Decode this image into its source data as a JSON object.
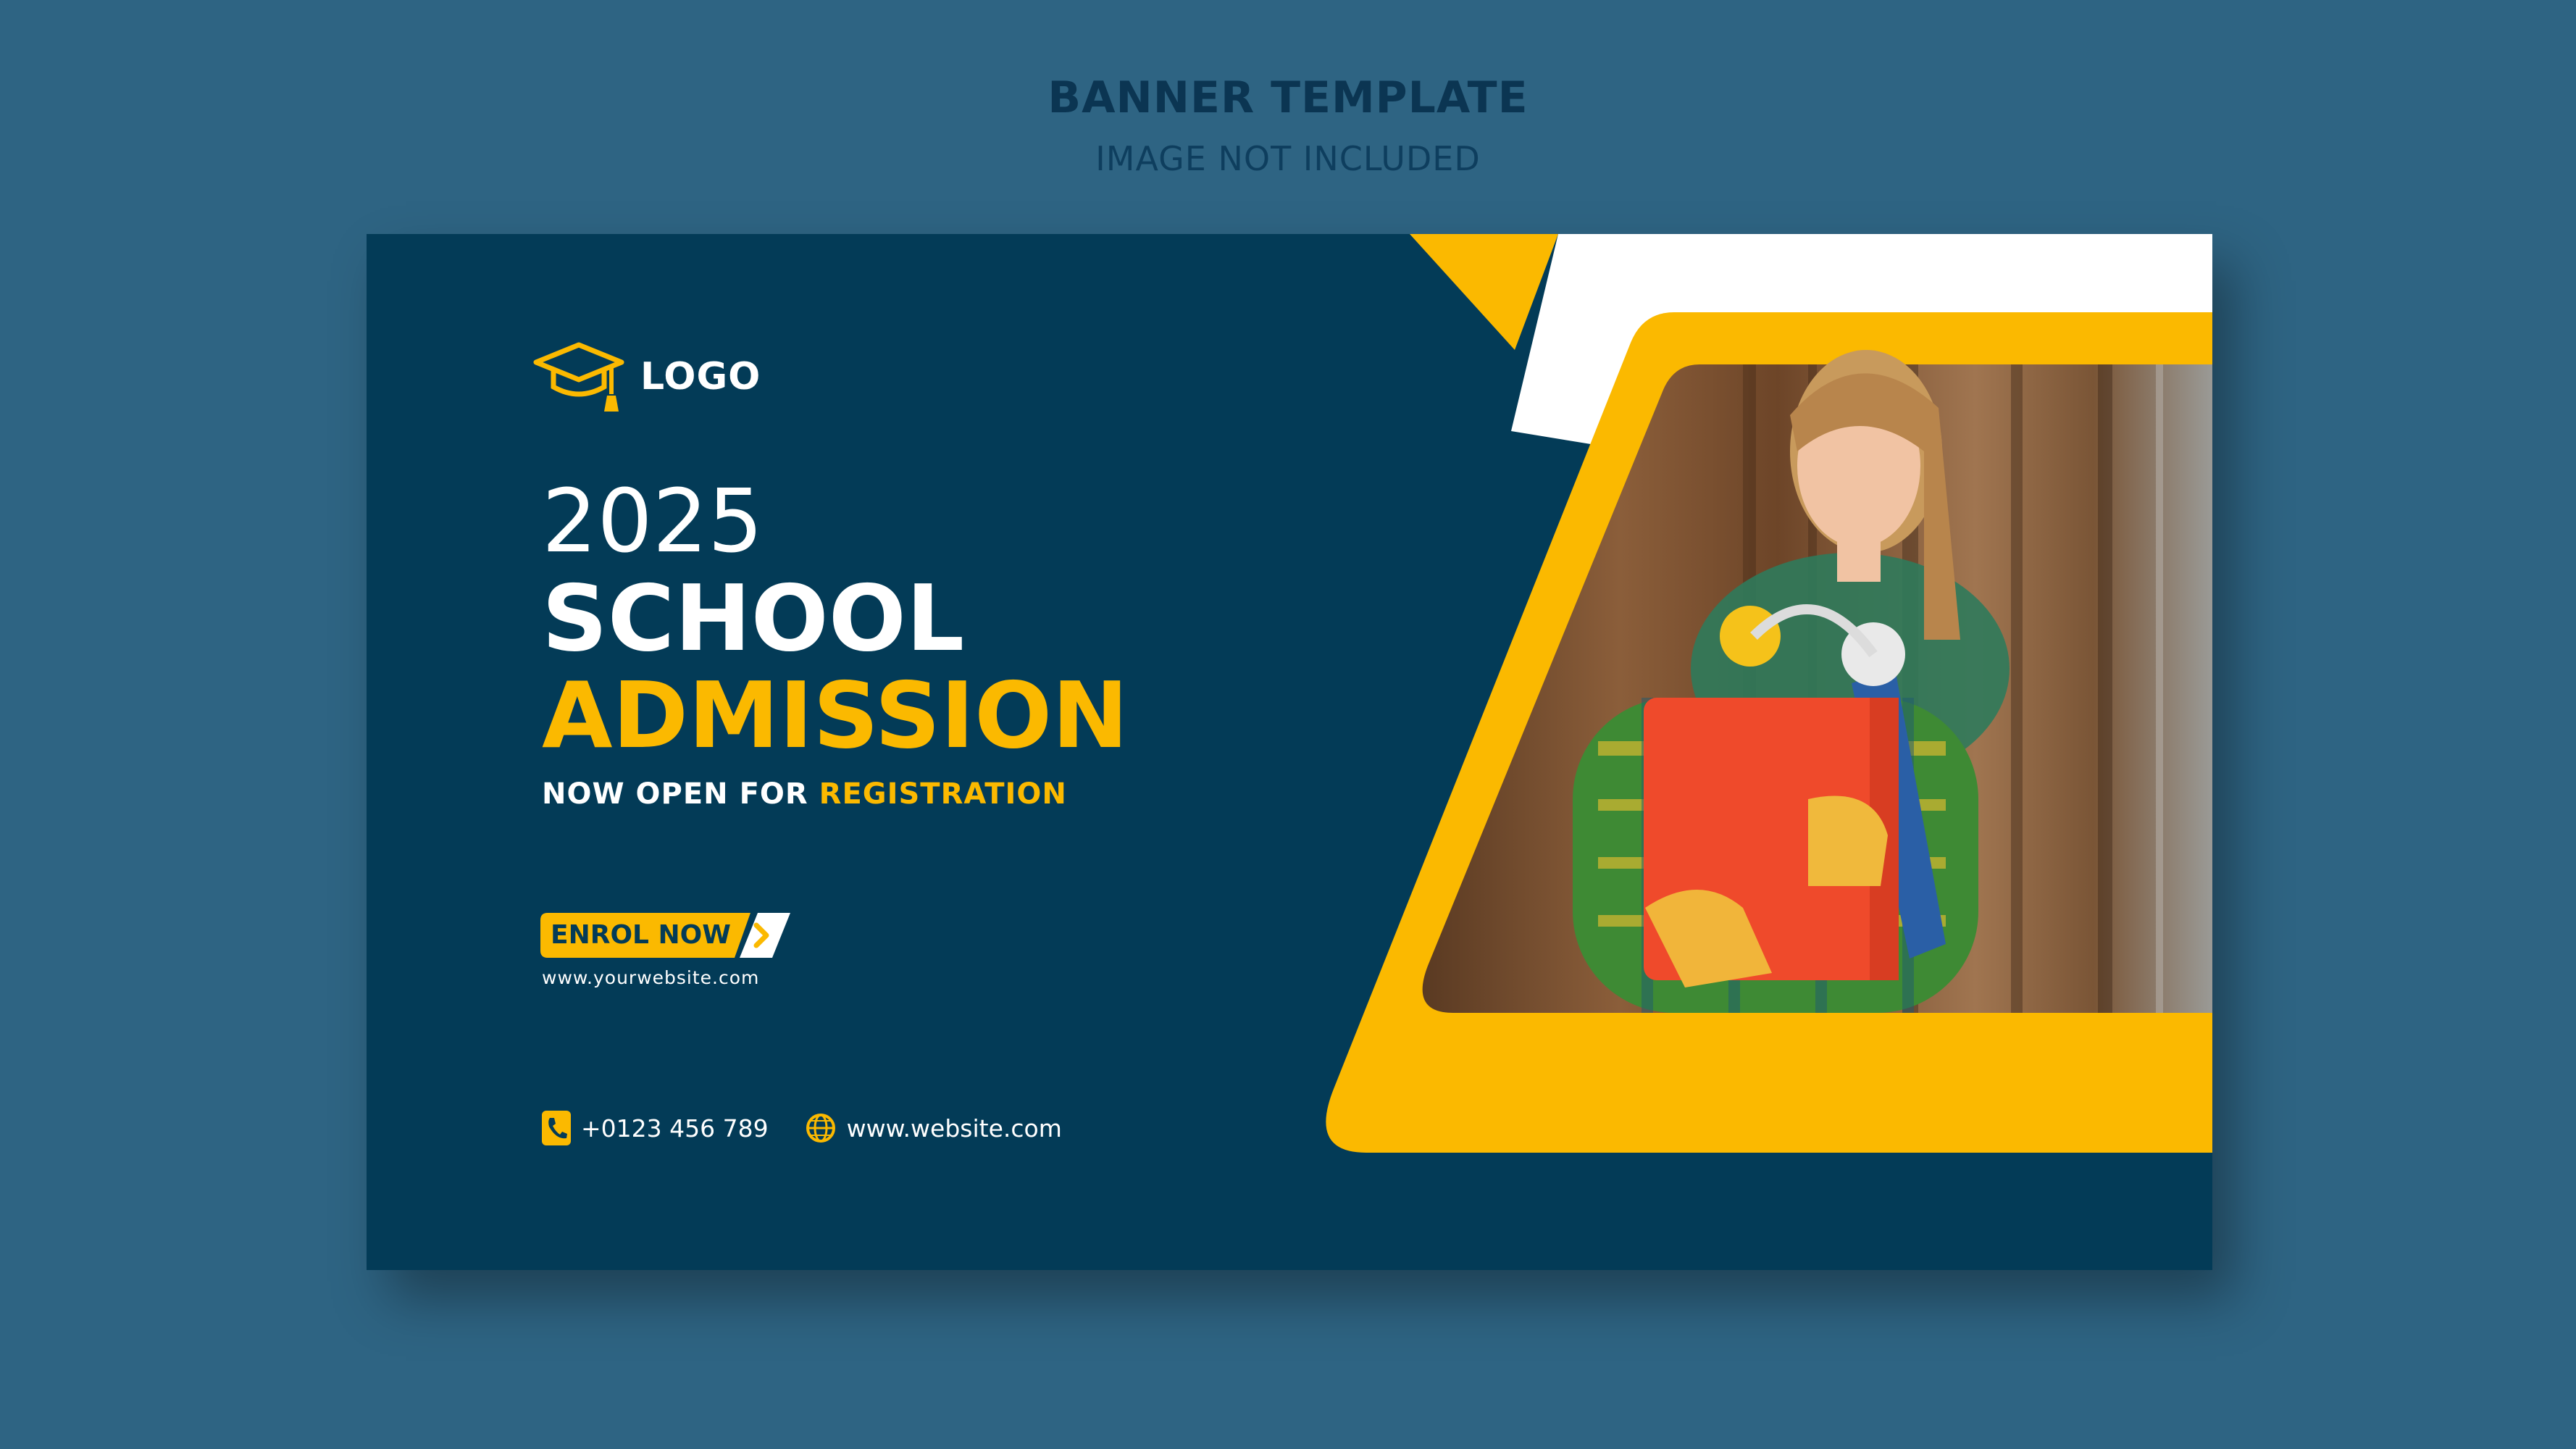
{
  "header": {
    "title": "BANNER TEMPLATE",
    "subtitle": "IMAGE NOT INCLUDED"
  },
  "banner": {
    "logo_text": "LOGO",
    "year": "2025",
    "headline_line1": "SCHOOL",
    "headline_line2": "ADMISSION",
    "tagline_prefix": "NOW OPEN FOR ",
    "tagline_accent": "REGISTRATION",
    "cta_label": "ENROL NOW",
    "cta_url": "www.yourwebsite.com",
    "phone": "+0123 456 789",
    "website": "www.website.com"
  },
  "colors": {
    "page_background": "#2e6483",
    "banner_background": "#033b57",
    "accent": "#fbb900",
    "text_light": "#ffffff"
  },
  "icons": [
    "graduation-cap-icon",
    "chevron-right-icon",
    "phone-icon",
    "globe-icon"
  ]
}
